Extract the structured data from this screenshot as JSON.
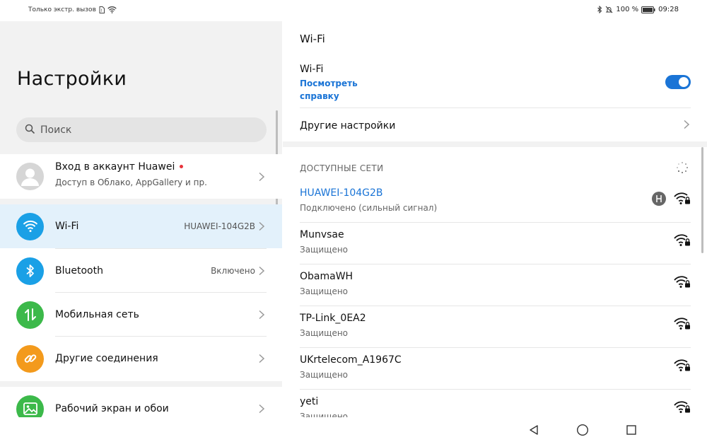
{
  "status": {
    "left_text": "Только экстр. вызов",
    "battery": "100 %",
    "time": "09:28"
  },
  "left": {
    "title": "Настройки",
    "search_placeholder": "Поиск",
    "account": {
      "title": "Вход в аккаунт Huawei",
      "subtitle": "Доступ в Облако, AppGallery и пр."
    },
    "items": [
      {
        "label": "Wi-Fi",
        "value": "HUAWEI-104G2B",
        "icon": "wifi-icon",
        "color": "#1aa0e6"
      },
      {
        "label": "Bluetooth",
        "value": "Включено",
        "icon": "bluetooth-icon",
        "color": "#1aa0e6"
      },
      {
        "label": "Мобильная сеть",
        "value": "",
        "icon": "mobile-data-icon",
        "color": "#3cb94a"
      },
      {
        "label": "Другие соединения",
        "value": "",
        "icon": "link-icon",
        "color": "#f39a1c"
      },
      {
        "label": "Рабочий экран и обои",
        "value": "",
        "icon": "image-icon",
        "color": "#3cb94a"
      }
    ]
  },
  "right": {
    "title": "Wi-Fi",
    "toggle_label": "Wi-Fi",
    "help_link": "Посмотреть справку",
    "more_settings": "Другие настройки",
    "section_header": "ДОСТУПНЫЕ СЕТИ",
    "networks": [
      {
        "name": "HUAWEI-104G2B",
        "status": "Подключено (сильный сигнал)"
      },
      {
        "name": "Munvsae",
        "status": "Защищено"
      },
      {
        "name": "ObamaWH",
        "status": "Защищено"
      },
      {
        "name": "TP-Link_0EA2",
        "status": "Защищено"
      },
      {
        "name": "UKrtelecom_A1967C",
        "status": "Защищено"
      },
      {
        "name": "yeti",
        "status": "Защищено"
      }
    ]
  },
  "colors": {
    "accent": "#1a74d6",
    "selected_bg": "#e3f1fb",
    "account_dot": "#e8333b"
  }
}
